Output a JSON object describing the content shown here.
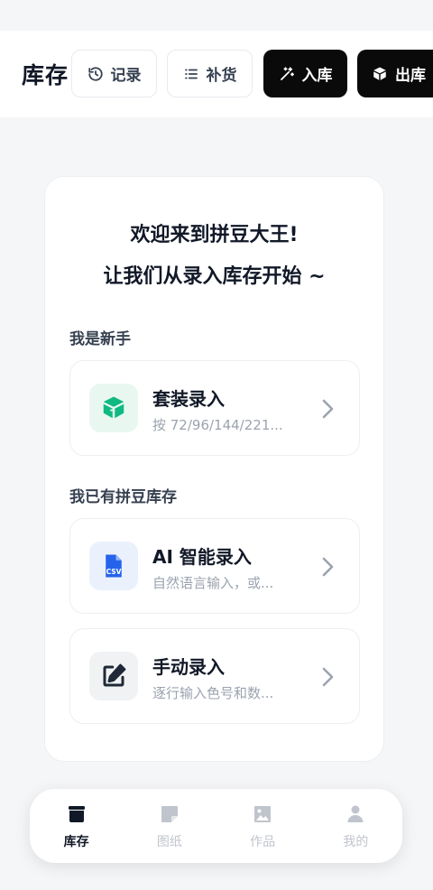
{
  "header": {
    "title": "库存",
    "buttons": {
      "history": "记录",
      "restock": "补货",
      "stock_in": "入库",
      "stock_out": "出库"
    }
  },
  "welcome": {
    "line1": "欢迎来到拼豆大王!",
    "line2": "让我们从录入库存开始 ~"
  },
  "sections": {
    "beginner": "我是新手",
    "existing": "我已有拼豆库存"
  },
  "options": {
    "kit": {
      "title": "套装录入",
      "desc": "按 72/96/144/221..."
    },
    "ai": {
      "title": "AI 智能录入",
      "desc": "自然语言输入，或..."
    },
    "manual": {
      "title": "手动录入",
      "desc": "逐行输入色号和数..."
    }
  },
  "tabs": [
    {
      "label": "库存",
      "active": true
    },
    {
      "label": "图纸",
      "active": false
    },
    {
      "label": "作品",
      "active": false
    },
    {
      "label": "我的",
      "active": false
    }
  ],
  "colors": {
    "kit_icon": "#10b981",
    "ai_icon": "#2563eb",
    "manual_icon": "#1f2937",
    "active_tab": "#111827",
    "inactive_tab": "#c0c4cc"
  }
}
